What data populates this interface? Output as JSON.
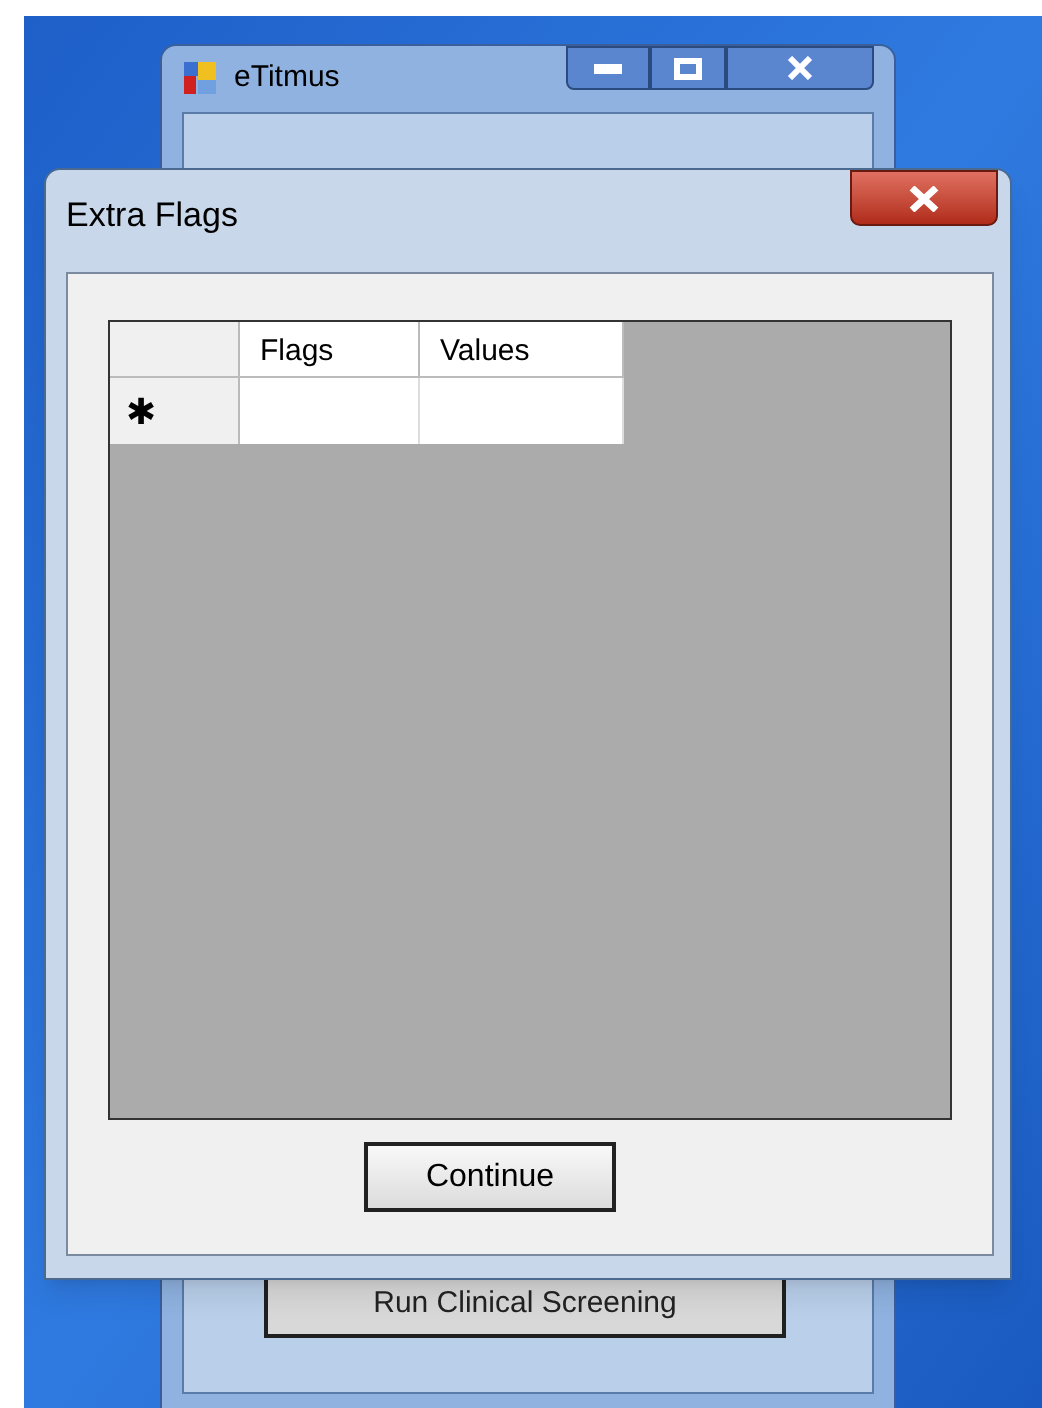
{
  "background_window": {
    "title": "eTitmus",
    "button": "Run Clinical Screening"
  },
  "dialog": {
    "title": "Extra Flags",
    "grid": {
      "columns": [
        "Flags",
        "Values"
      ],
      "new_row_marker": "✱"
    },
    "buttons": [
      "Continue"
    ]
  }
}
